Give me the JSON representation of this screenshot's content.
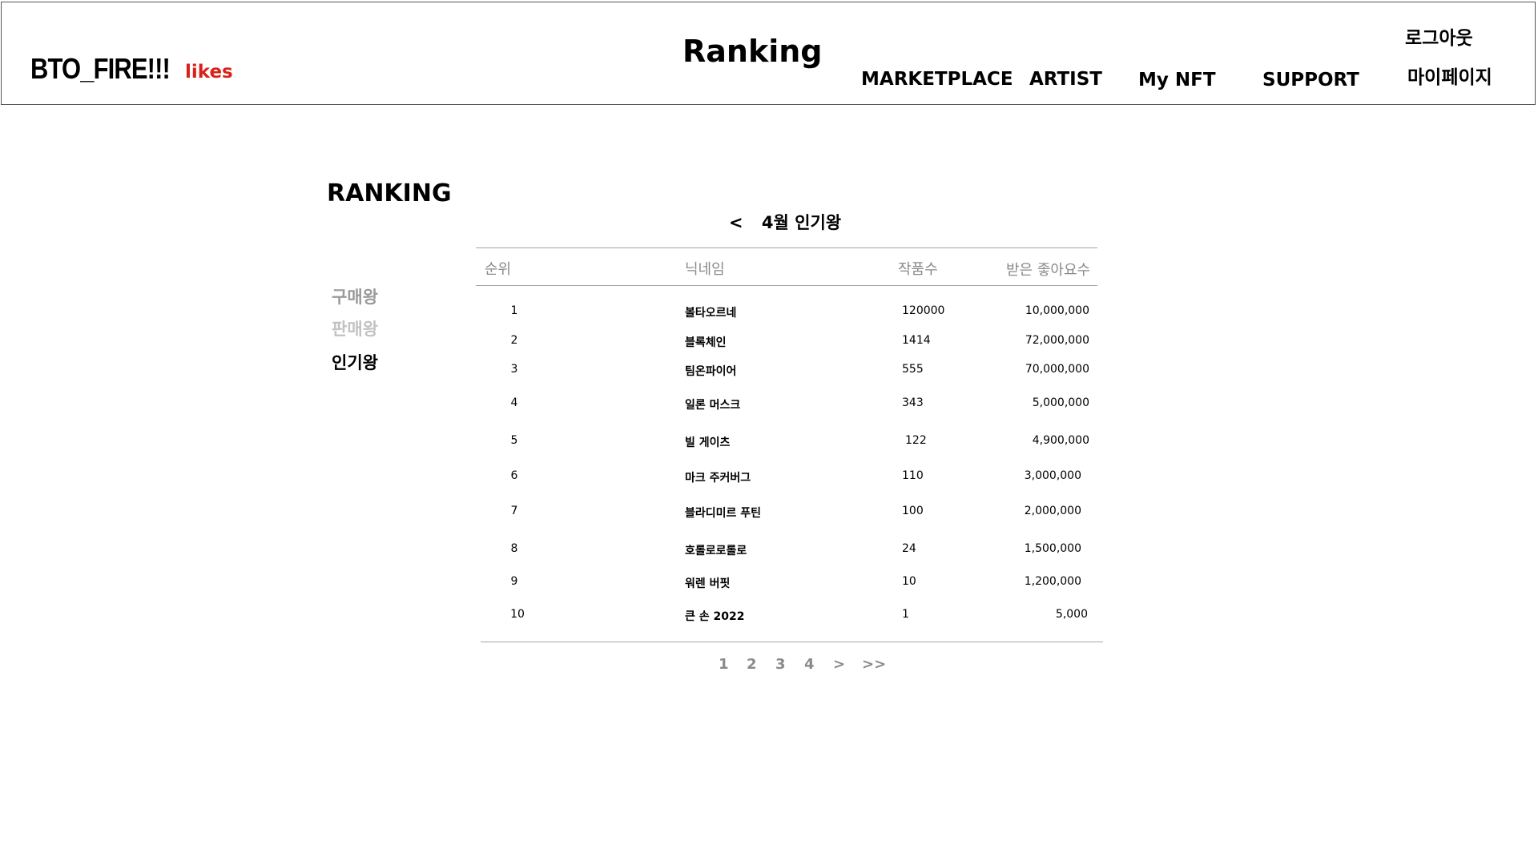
{
  "header": {
    "brand": "BTO_FIRE!!!",
    "likes": "likes",
    "title": "Ranking",
    "nav": {
      "marketplace": "MARKETPLACE",
      "artist": "ARTIST",
      "my_nft": "My NFT",
      "support": "SUPPORT",
      "logout": "로그아웃",
      "mypage": "마이페이지"
    }
  },
  "section_title": "RANKING",
  "sidebar": {
    "items": [
      {
        "label": "구매왕"
      },
      {
        "label": "판매왕"
      },
      {
        "label": "인기왕"
      }
    ]
  },
  "period": {
    "prev": "<",
    "label": "4월 인기왕"
  },
  "table": {
    "headers": {
      "rank": "순위",
      "nickname": "닉네임",
      "works": "작품수",
      "likes": "받은 좋아요수"
    },
    "rows": [
      {
        "rank": "1",
        "nickname": "볼타오르네",
        "works": "120000",
        "likes": "10,000,000"
      },
      {
        "rank": "2",
        "nickname": "블록체인",
        "works": "1414",
        "likes": "72,000,000"
      },
      {
        "rank": "3",
        "nickname": "팀온파이어",
        "works": "555",
        "likes": "70,000,000"
      },
      {
        "rank": "4",
        "nickname": "일론 머스크",
        "works": "343",
        "likes": "5,000,000"
      },
      {
        "rank": "5",
        "nickname": "빌 게이츠",
        "works": "122",
        "likes": "4,900,000"
      },
      {
        "rank": "6",
        "nickname": "마크 주커버그",
        "works": "110",
        "likes": "3,000,000"
      },
      {
        "rank": "7",
        "nickname": "블라디미르 푸틴",
        "works": "100",
        "likes": "2,000,000"
      },
      {
        "rank": "8",
        "nickname": "호롤로로롤로",
        "works": "24",
        "likes": "1,500,000"
      },
      {
        "rank": "9",
        "nickname": "워렌 버핏",
        "works": "10",
        "likes": "1,200,000"
      },
      {
        "rank": "10",
        "nickname": "큰 손 2022",
        "works": "1",
        "likes": "5,000"
      }
    ]
  },
  "pagination": {
    "pages": [
      "1",
      "2",
      "3",
      "4"
    ],
    "next": ">",
    "last": ">>"
  }
}
